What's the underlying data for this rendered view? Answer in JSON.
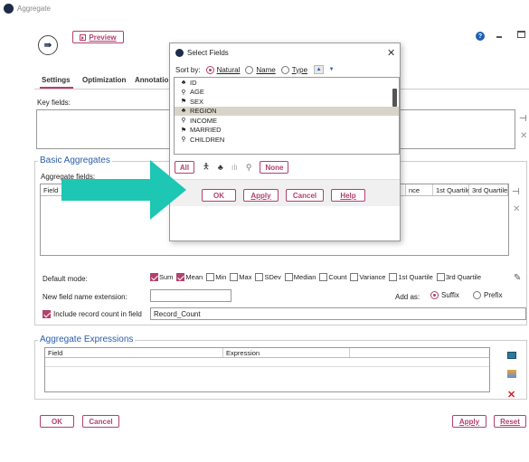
{
  "window": {
    "title": "Aggregate"
  },
  "toolbar": {
    "preview_label": "Preview",
    "help_glyph": "?"
  },
  "tabs": [
    {
      "label": "Settings"
    },
    {
      "label": "Optimization"
    },
    {
      "label": "Annotatio"
    }
  ],
  "key_fields": {
    "label": "Key fields:"
  },
  "basic_aggregates": {
    "title": "Basic Aggregates",
    "fields_label": "Aggregate fields:",
    "columns": [
      "Field",
      "nce",
      "1st Quartile",
      "3rd Quartile"
    ]
  },
  "default_mode": {
    "label": "Default mode:",
    "options": [
      {
        "label": "Sum",
        "checked": true
      },
      {
        "label": "Mean",
        "checked": true
      },
      {
        "label": "Min",
        "checked": false
      },
      {
        "label": "Max",
        "checked": false
      },
      {
        "label": "SDev",
        "checked": false
      },
      {
        "label": "Median",
        "checked": false
      },
      {
        "label": "Count",
        "checked": false
      },
      {
        "label": "Variance",
        "checked": false
      },
      {
        "label": "1st Quartile",
        "checked": false
      },
      {
        "label": "3rd Quartile",
        "checked": false
      }
    ]
  },
  "extension": {
    "label": "New field name extension:",
    "value": "",
    "add_as_label": "Add as:",
    "suffix_label": "Suffix",
    "prefix_label": "Prefix",
    "selected": "Suffix"
  },
  "record_count": {
    "label": "Include record count in field",
    "checked": true,
    "value": "Record_Count"
  },
  "aggregate_expressions": {
    "title": "Aggregate Expressions",
    "columns": [
      "Field",
      "Expression"
    ]
  },
  "footer": {
    "ok_label": "OK",
    "cancel_label": "Cancel",
    "apply_label": "Apply",
    "reset_label": "Reset"
  },
  "dialog": {
    "title": "Select Fields",
    "close_glyph": "✕",
    "sort_label": "Sort by:",
    "sort_options": [
      "Natural",
      "Name",
      "Type"
    ],
    "sort_selected": "Natural",
    "fields": [
      {
        "name": "ID",
        "icon": "nominal-icon"
      },
      {
        "name": "AGE",
        "icon": "continuous-icon"
      },
      {
        "name": "SEX",
        "icon": "flag-icon"
      },
      {
        "name": "REGION",
        "icon": "nominal-icon",
        "selected": true
      },
      {
        "name": "INCOME",
        "icon": "continuous-icon"
      },
      {
        "name": "MARRIED",
        "icon": "flag-icon"
      },
      {
        "name": "CHILDREN",
        "icon": "continuous-icon"
      }
    ],
    "all_label": "All",
    "none_label": "None",
    "ok_label": "OK",
    "apply_label": "Apply",
    "cancel_label": "Cancel",
    "help_label": "Help"
  },
  "colors": {
    "accent": "#b3406e",
    "link_blue": "#2a5cae",
    "annotation_arrow": "#1ec6b4"
  }
}
